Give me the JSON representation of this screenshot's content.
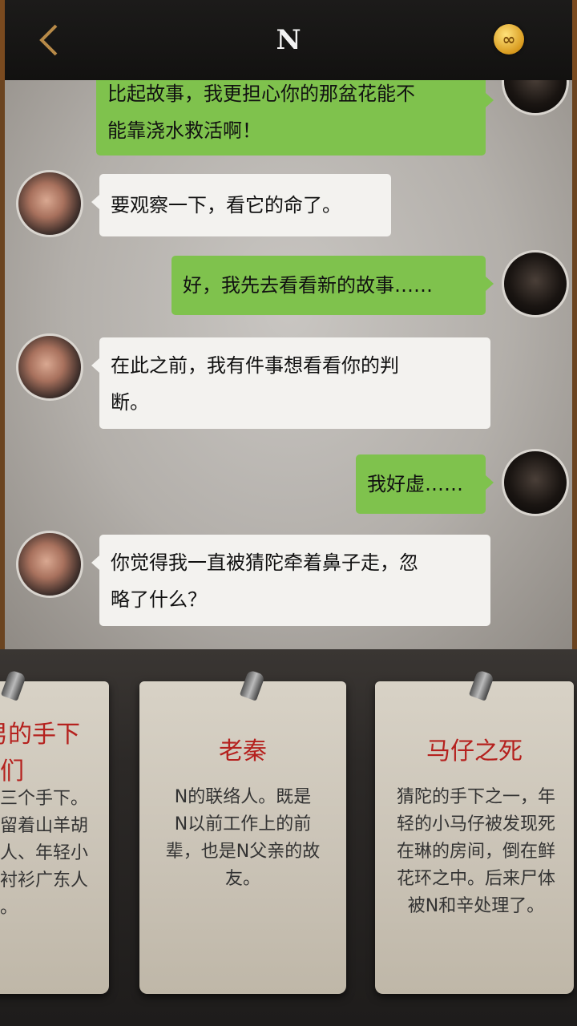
{
  "header": {
    "title": "N",
    "back_icon": "chevron-left-icon",
    "coin_icon": "infinity-coin-icon",
    "coin_symbol": "∞"
  },
  "messages": [
    {
      "side": "right",
      "lines": [
        "比起故事，我更担心你的那盆花能不",
        "能靠浇水救活啊！"
      ]
    },
    {
      "side": "left",
      "lines": [
        "要观察一下，看它的命了。"
      ]
    },
    {
      "side": "right",
      "lines": [
        "好，我先去看看新的故事……"
      ]
    },
    {
      "side": "left",
      "lines": [
        "在此之前，我有件事想看看你的判",
        "断。"
      ]
    },
    {
      "side": "right",
      "lines": [
        "我好虚……"
      ]
    },
    {
      "side": "left",
      "lines": [
        "你觉得我一直被猜陀牵着鼻子走，忽",
        "略了什么？"
      ]
    }
  ],
  "cards": [
    {
      "title": "男的手下们",
      "title_lines": [
        "男的手下",
        "们"
      ],
      "text_lines": [
        "三个手下。",
        "留着山羊胡",
        "人、年轻小",
        "衬衫广东人",
        "。"
      ]
    },
    {
      "title": "老秦",
      "title_lines": [
        "老秦"
      ],
      "text_lines": [
        "N的联络人。既是",
        "N以前工作上的前",
        "辈，也是N父亲的故",
        "友。"
      ]
    },
    {
      "title": "马仔之死",
      "title_lines": [
        "马仔之死"
      ],
      "text_lines": [
        "猜陀的手下之一，年",
        "轻的小马仔被发现死",
        "在琳的房间，倒在鲜",
        "花环之中。后来尸体",
        "被N和辛处理了。"
      ]
    }
  ]
}
